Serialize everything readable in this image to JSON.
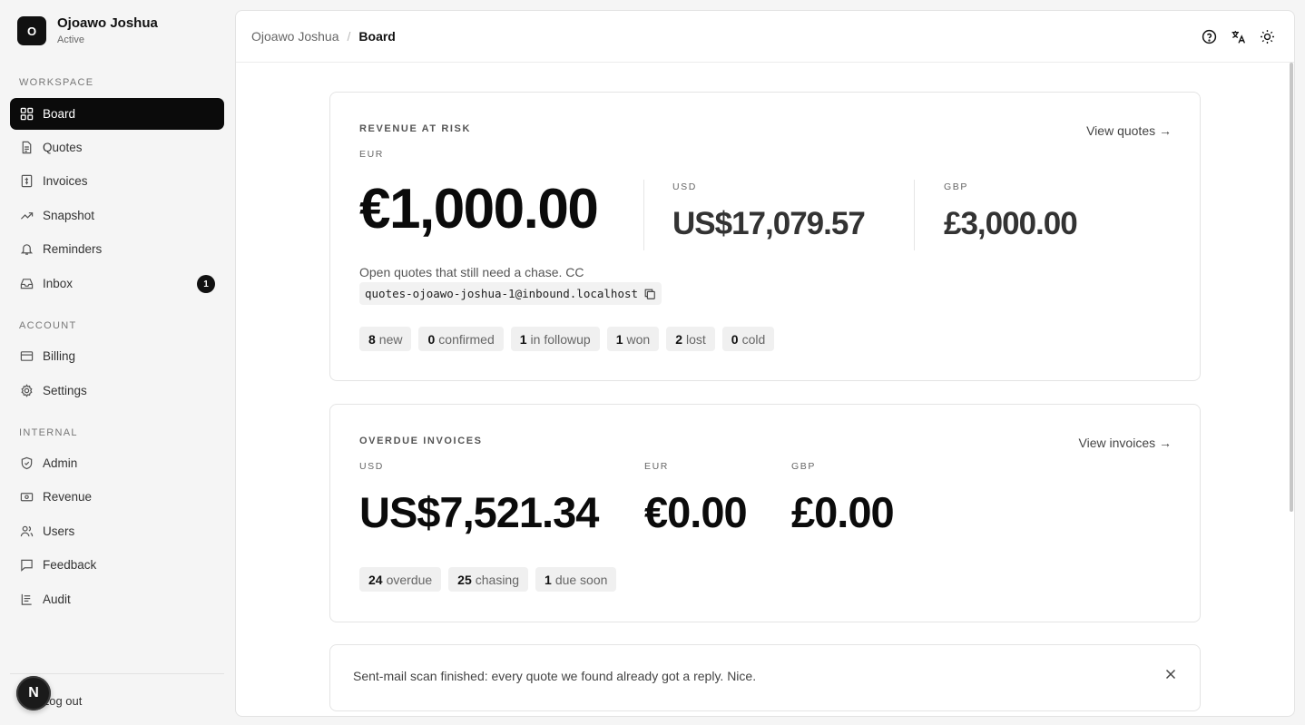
{
  "user": {
    "initial": "O",
    "name": "Ojoawo Joshua",
    "status": "Active"
  },
  "sidebar": {
    "sections": {
      "workspace": "WORKSPACE",
      "account": "ACCOUNT",
      "internal": "INTERNAL"
    },
    "items": [
      {
        "label": "Board",
        "icon": "grid-icon",
        "active": true
      },
      {
        "label": "Quotes",
        "icon": "document-icon"
      },
      {
        "label": "Invoices",
        "icon": "invoice-icon"
      },
      {
        "label": "Snapshot",
        "icon": "trend-icon"
      },
      {
        "label": "Reminders",
        "icon": "bell-icon"
      },
      {
        "label": "Inbox",
        "icon": "inbox-icon",
        "badge": "1"
      },
      {
        "label": "Billing",
        "icon": "card-icon"
      },
      {
        "label": "Settings",
        "icon": "gear-icon"
      },
      {
        "label": "Admin",
        "icon": "shield-icon"
      },
      {
        "label": "Revenue",
        "icon": "cash-icon"
      },
      {
        "label": "Users",
        "icon": "users-icon"
      },
      {
        "label": "Feedback",
        "icon": "message-icon"
      },
      {
        "label": "Audit",
        "icon": "list-icon"
      }
    ],
    "logout": "Log out",
    "n_badge": "N"
  },
  "header": {
    "breadcrumb_parent": "Ojoawo Joshua",
    "breadcrumb_sep": "/",
    "breadcrumb_current": "Board"
  },
  "revenue": {
    "title": "REVENUE AT RISK",
    "link": "View quotes →",
    "primary_currency": "EUR",
    "primary_amount": "€1,000.00",
    "usd_label": "USD",
    "usd_amount": "US$17,079.57",
    "gbp_label": "GBP",
    "gbp_amount": "£3,000.00",
    "description": "Open quotes that still need a chase. CC",
    "email": "quotes-ojoawo-joshua-1@inbound.localhost",
    "pills": [
      {
        "count": "8",
        "label": "new"
      },
      {
        "count": "0",
        "label": "confirmed"
      },
      {
        "count": "1",
        "label": "in followup"
      },
      {
        "count": "1",
        "label": "won"
      },
      {
        "count": "2",
        "label": "lost"
      },
      {
        "count": "0",
        "label": "cold"
      }
    ]
  },
  "overdue": {
    "title": "OVERDUE INVOICES",
    "link": "View invoices →",
    "usd_label": "USD",
    "usd_amount": "US$7,521.34",
    "eur_label": "EUR",
    "eur_amount": "€0.00",
    "gbp_label": "GBP",
    "gbp_amount": "£0.00",
    "pills": [
      {
        "count": "24",
        "label": "overdue"
      },
      {
        "count": "25",
        "label": "chasing"
      },
      {
        "count": "1",
        "label": "due soon"
      }
    ]
  },
  "toast": {
    "text": "Sent-mail scan finished: every quote we found already got a reply. Nice."
  }
}
